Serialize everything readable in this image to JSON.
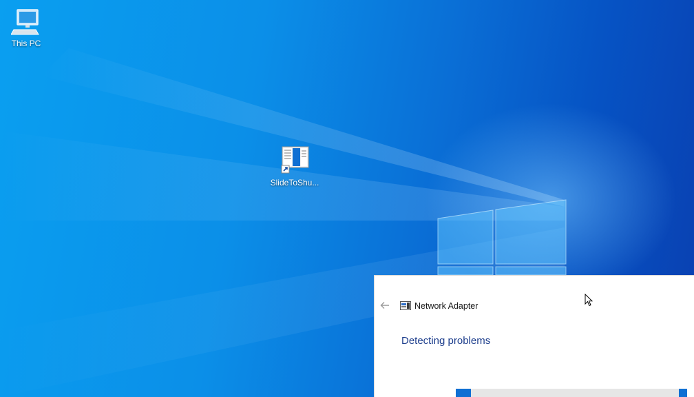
{
  "desktop": {
    "icons": [
      {
        "label": "This PC",
        "icon": "computer-icon"
      },
      {
        "label": "SlideToShu...",
        "icon": "shortcut-app-icon"
      }
    ]
  },
  "dialog": {
    "back_icon": "back-arrow-icon",
    "title": "Network Adapter",
    "title_icon": "network-adapter-icon",
    "status": "Detecting problems",
    "progress_indeterminate": true
  },
  "colors": {
    "desktop_blue": "#0a8fe8",
    "heading_blue": "#1c3d8c",
    "progress_blue": "#0f6fd3"
  }
}
